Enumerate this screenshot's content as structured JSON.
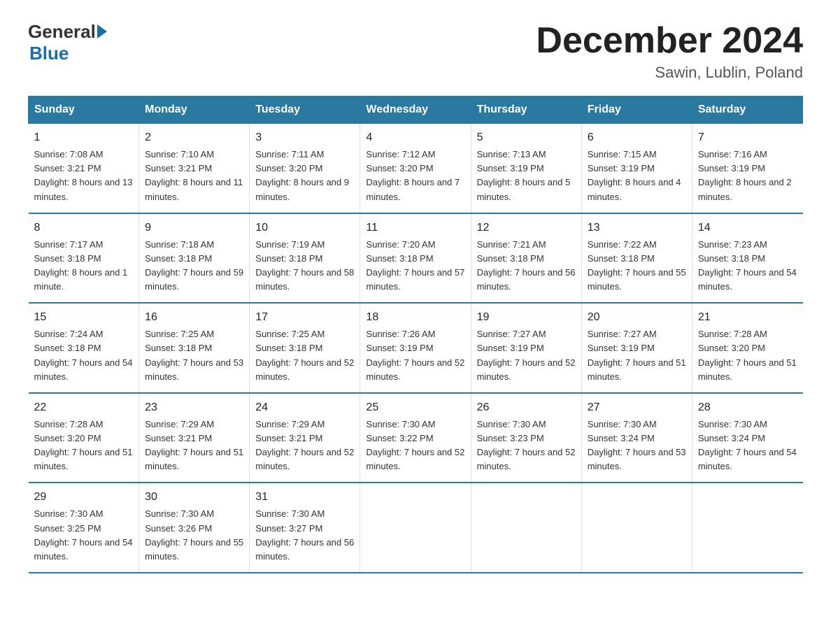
{
  "logo": {
    "general": "General",
    "blue": "Blue"
  },
  "title": "December 2024",
  "location": "Sawin, Lublin, Poland",
  "header_color": "#2979a0",
  "days_of_week": [
    "Sunday",
    "Monday",
    "Tuesday",
    "Wednesday",
    "Thursday",
    "Friday",
    "Saturday"
  ],
  "weeks": [
    [
      {
        "day": "1",
        "sunrise": "7:08 AM",
        "sunset": "3:21 PM",
        "daylight": "8 hours and 13 minutes."
      },
      {
        "day": "2",
        "sunrise": "7:10 AM",
        "sunset": "3:21 PM",
        "daylight": "8 hours and 11 minutes."
      },
      {
        "day": "3",
        "sunrise": "7:11 AM",
        "sunset": "3:20 PM",
        "daylight": "8 hours and 9 minutes."
      },
      {
        "day": "4",
        "sunrise": "7:12 AM",
        "sunset": "3:20 PM",
        "daylight": "8 hours and 7 minutes."
      },
      {
        "day": "5",
        "sunrise": "7:13 AM",
        "sunset": "3:19 PM",
        "daylight": "8 hours and 5 minutes."
      },
      {
        "day": "6",
        "sunrise": "7:15 AM",
        "sunset": "3:19 PM",
        "daylight": "8 hours and 4 minutes."
      },
      {
        "day": "7",
        "sunrise": "7:16 AM",
        "sunset": "3:19 PM",
        "daylight": "8 hours and 2 minutes."
      }
    ],
    [
      {
        "day": "8",
        "sunrise": "7:17 AM",
        "sunset": "3:18 PM",
        "daylight": "8 hours and 1 minute."
      },
      {
        "day": "9",
        "sunrise": "7:18 AM",
        "sunset": "3:18 PM",
        "daylight": "7 hours and 59 minutes."
      },
      {
        "day": "10",
        "sunrise": "7:19 AM",
        "sunset": "3:18 PM",
        "daylight": "7 hours and 58 minutes."
      },
      {
        "day": "11",
        "sunrise": "7:20 AM",
        "sunset": "3:18 PM",
        "daylight": "7 hours and 57 minutes."
      },
      {
        "day": "12",
        "sunrise": "7:21 AM",
        "sunset": "3:18 PM",
        "daylight": "7 hours and 56 minutes."
      },
      {
        "day": "13",
        "sunrise": "7:22 AM",
        "sunset": "3:18 PM",
        "daylight": "7 hours and 55 minutes."
      },
      {
        "day": "14",
        "sunrise": "7:23 AM",
        "sunset": "3:18 PM",
        "daylight": "7 hours and 54 minutes."
      }
    ],
    [
      {
        "day": "15",
        "sunrise": "7:24 AM",
        "sunset": "3:18 PM",
        "daylight": "7 hours and 54 minutes."
      },
      {
        "day": "16",
        "sunrise": "7:25 AM",
        "sunset": "3:18 PM",
        "daylight": "7 hours and 53 minutes."
      },
      {
        "day": "17",
        "sunrise": "7:25 AM",
        "sunset": "3:18 PM",
        "daylight": "7 hours and 52 minutes."
      },
      {
        "day": "18",
        "sunrise": "7:26 AM",
        "sunset": "3:19 PM",
        "daylight": "7 hours and 52 minutes."
      },
      {
        "day": "19",
        "sunrise": "7:27 AM",
        "sunset": "3:19 PM",
        "daylight": "7 hours and 52 minutes."
      },
      {
        "day": "20",
        "sunrise": "7:27 AM",
        "sunset": "3:19 PM",
        "daylight": "7 hours and 51 minutes."
      },
      {
        "day": "21",
        "sunrise": "7:28 AM",
        "sunset": "3:20 PM",
        "daylight": "7 hours and 51 minutes."
      }
    ],
    [
      {
        "day": "22",
        "sunrise": "7:28 AM",
        "sunset": "3:20 PM",
        "daylight": "7 hours and 51 minutes."
      },
      {
        "day": "23",
        "sunrise": "7:29 AM",
        "sunset": "3:21 PM",
        "daylight": "7 hours and 51 minutes."
      },
      {
        "day": "24",
        "sunrise": "7:29 AM",
        "sunset": "3:21 PM",
        "daylight": "7 hours and 52 minutes."
      },
      {
        "day": "25",
        "sunrise": "7:30 AM",
        "sunset": "3:22 PM",
        "daylight": "7 hours and 52 minutes."
      },
      {
        "day": "26",
        "sunrise": "7:30 AM",
        "sunset": "3:23 PM",
        "daylight": "7 hours and 52 minutes."
      },
      {
        "day": "27",
        "sunrise": "7:30 AM",
        "sunset": "3:24 PM",
        "daylight": "7 hours and 53 minutes."
      },
      {
        "day": "28",
        "sunrise": "7:30 AM",
        "sunset": "3:24 PM",
        "daylight": "7 hours and 54 minutes."
      }
    ],
    [
      {
        "day": "29",
        "sunrise": "7:30 AM",
        "sunset": "3:25 PM",
        "daylight": "7 hours and 54 minutes."
      },
      {
        "day": "30",
        "sunrise": "7:30 AM",
        "sunset": "3:26 PM",
        "daylight": "7 hours and 55 minutes."
      },
      {
        "day": "31",
        "sunrise": "7:30 AM",
        "sunset": "3:27 PM",
        "daylight": "7 hours and 56 minutes."
      },
      null,
      null,
      null,
      null
    ]
  ]
}
